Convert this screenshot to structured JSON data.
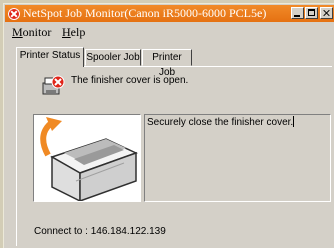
{
  "window": {
    "title": "NetSpot Job Monitor(Canon iR5000-6000 PCL5e)",
    "buttons": [
      "minimize",
      "maximize",
      "close"
    ]
  },
  "menu": [
    {
      "label": "Monitor",
      "key": "M",
      "rest": "onitor"
    },
    {
      "label": "Help",
      "key": "H",
      "rest": "elp"
    }
  ],
  "tabs": [
    {
      "label": "Printer Status",
      "active": true
    },
    {
      "label": "Spooler Job",
      "active": false
    },
    {
      "label": "Printer Job",
      "active": false
    }
  ],
  "status": {
    "icon": "printer-error-icon",
    "message": "The finisher cover is open."
  },
  "detail": {
    "illustration": "finisher-cover-open-illustration",
    "instruction": "Securely close the finisher cover."
  },
  "connection": {
    "label": "Connect to :",
    "address": "146.184.122.139"
  },
  "colors": {
    "title_bar": "#e8771a",
    "error_accent": "#e02418",
    "arrow": "#f08a24",
    "face": "#d4d0c8"
  }
}
